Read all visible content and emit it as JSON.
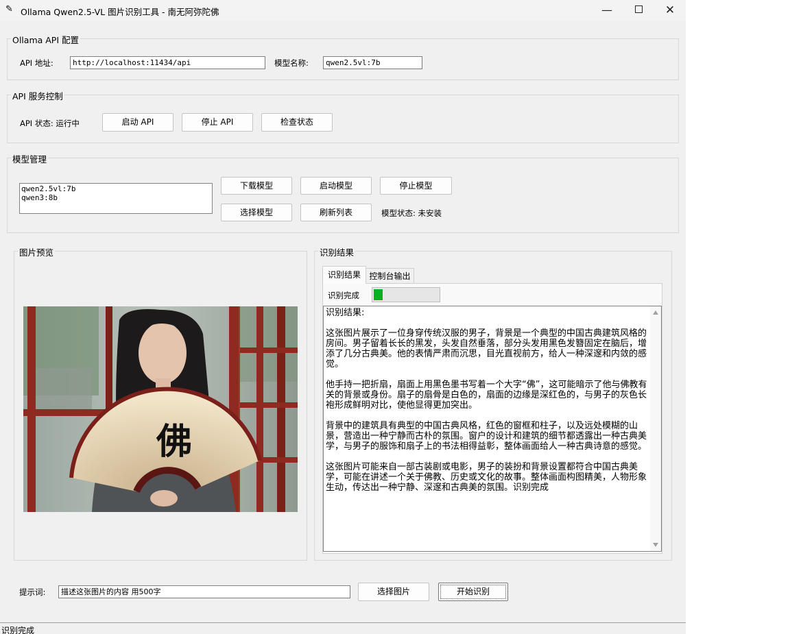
{
  "window": {
    "title": "Ollama Qwen2.5-VL 图片识别工具 - 南无阿弥陀佛",
    "icon": "feather-icon",
    "controls": {
      "minimize": "—",
      "maximize": "maximize-icon",
      "close": "✕"
    }
  },
  "api_config": {
    "title": "Ollama API 配置",
    "url_label": "API 地址:",
    "url_value": "http://localhost:11434/api",
    "model_label": "模型名称:",
    "model_value": "qwen2.5vl:7b"
  },
  "service": {
    "title": "API 服务控制",
    "status_text": "API 状态: 运行中",
    "buttons": {
      "start": "启动 API",
      "stop": "停止 API",
      "check": "检查状态"
    }
  },
  "models": {
    "title": "模型管理",
    "list": [
      "qwen2.5vl:7b",
      "qwen3:8b"
    ],
    "buttons": {
      "download": "下载模型",
      "start": "启动模型",
      "stop": "停止模型",
      "select": "选择模型",
      "refresh": "刷新列表"
    },
    "status_text": "模型状态: 未安装"
  },
  "preview": {
    "title": "图片预览"
  },
  "result": {
    "title": "识别结果",
    "tabs": [
      "识别结果",
      "控制台输出"
    ],
    "progress_label": "识别完成",
    "progress_fraction": 0.15,
    "text_heading": "识别结果:",
    "paragraphs": [
      "这张图片展示了一位身穿传统汉服的男子，背景是一个典型的中国古典建筑风格的房间。男子留着长长的黑发，头发自然垂落，部分头发用黑色发簪固定在脑后，增添了几分古典美。他的表情严肃而沉思，目光直视前方，给人一种深邃和内敛的感觉。",
      "他手持一把折扇，扇面上用黑色墨书写着一个大字“佛”，这可能暗示了他与佛教有关的背景或身份。扇子的扇骨是白色的，扇面的边缘是深红色的，与男子的灰色长袍形成鲜明对比，使他显得更加突出。",
      "背景中的建筑具有典型的中国古典风格，红色的窗框和柱子，以及远处模糊的山景，营造出一种宁静而古朴的氛围。窗户的设计和建筑的细节都透露出一种古典美学，与男子的服饰和扇子上的书法相得益彰，整体画面给人一种古典诗意的感觉。",
      "这张图片可能来自一部古装剧或电影，男子的装扮和背景设置都符合中国古典美学，可能在讲述一个关于佛教、历史或文化的故事。整体画面构图精美，人物形象生动，传达出一种宁静、深邃和古典美的氛围。识别完成"
    ]
  },
  "prompt": {
    "label": "提示词:",
    "value": "描述这张图片的内容 用500字",
    "select_image": "选择图片",
    "start": "开始识别"
  },
  "statusbar": {
    "text": "识别完成"
  },
  "fan_character": "佛",
  "colors": {
    "progress": "#06b025",
    "pillar_red": "#8e2a20",
    "robe_gray": "#4f5355"
  }
}
